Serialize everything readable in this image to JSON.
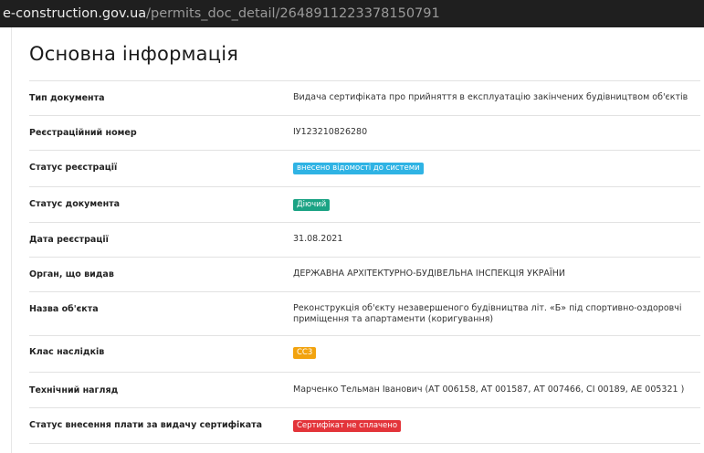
{
  "browser": {
    "url_host": "e-construction.gov.ua",
    "url_path": "/permits_doc_detail/2648911223378150791"
  },
  "page": {
    "title": "Основна інформація"
  },
  "fields": [
    {
      "label": "Тип документа",
      "value": "Видача сертифіката про прийняття в експлуатацію закінчених будівництвом об'єктів"
    },
    {
      "label": "Реєстраційний номер",
      "value": "ІУ123210826280"
    },
    {
      "label": "Статус реєстрації",
      "value": "внесено відомості до системи"
    },
    {
      "label": "Статус документа",
      "value": "Діючий"
    },
    {
      "label": "Дата реєстрації",
      "value": "31.08.2021"
    },
    {
      "label": "Орган, що видав",
      "value": "ДЕРЖАВНА АРХІТЕКТУРНО-БУДІВЕЛЬНА ІНСПЕКЦІЯ УКРАЇНИ"
    },
    {
      "label": "Назва об'єкта",
      "value": "Реконструкція об'єкту незавершеного будівництва літ. «Б» під спортивно-оздоровчі приміщення та апартаменти (коригування)"
    },
    {
      "label": "Клас наслідків",
      "value": "СС3"
    },
    {
      "label": "Технічний нагляд",
      "value": "Марченко Тельман Іванович (АТ 006158, АТ 001587, АТ 007466, СІ 00189, АЕ 005321 )"
    },
    {
      "label": "Статус внесення плати за видачу сертифіката",
      "value": "Сертифікат не сплачено"
    }
  ],
  "colors": {
    "badge_blue": "#2fb3e4",
    "badge_green": "#1ba384",
    "badge_orange": "#f2a30f",
    "badge_red": "#e3343a"
  }
}
